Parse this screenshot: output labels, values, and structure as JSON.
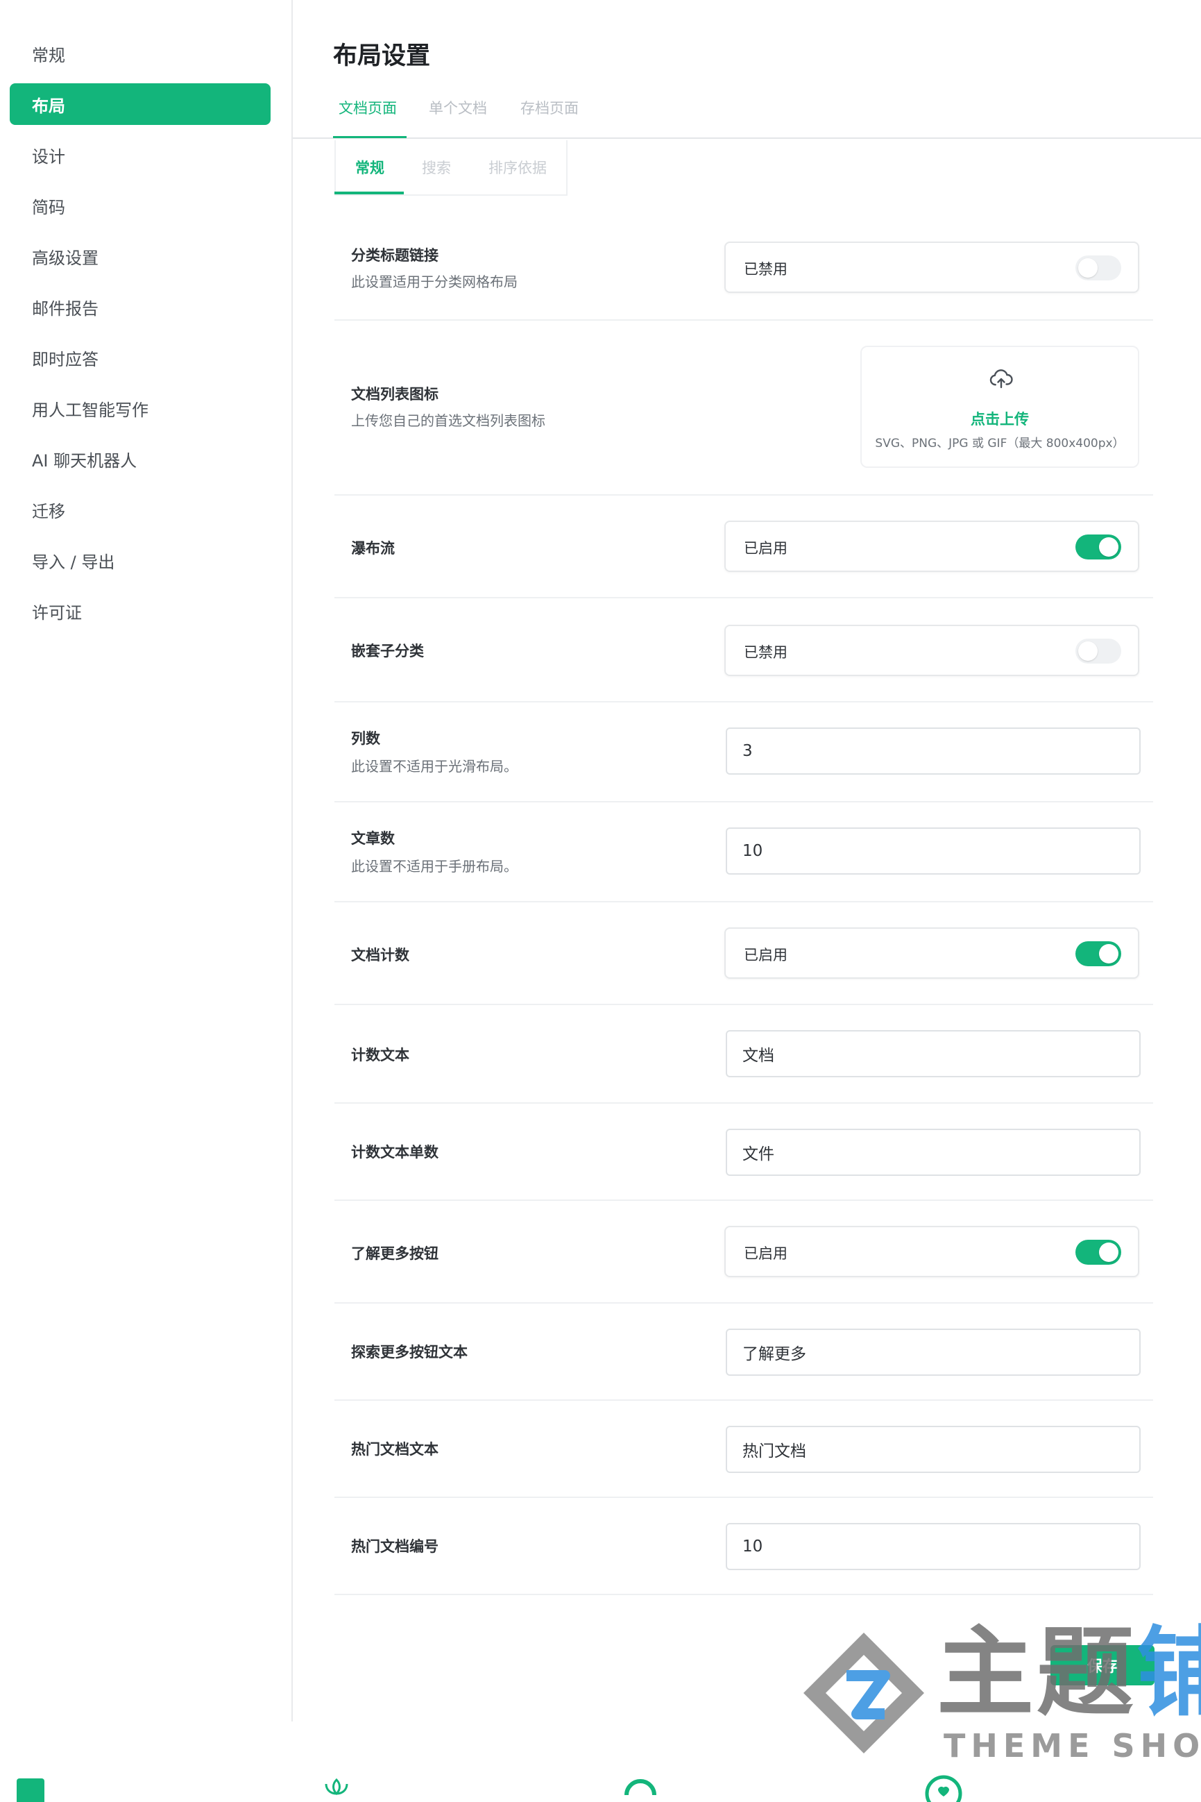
{
  "sidebar": {
    "items": [
      {
        "label": "常规",
        "active": false
      },
      {
        "label": "布局",
        "active": true
      },
      {
        "label": "设计",
        "active": false
      },
      {
        "label": "简码",
        "active": false
      },
      {
        "label": "高级设置",
        "active": false
      },
      {
        "label": "邮件报告",
        "active": false
      },
      {
        "label": "即时应答",
        "active": false
      },
      {
        "label": "用人工智能写作",
        "active": false
      },
      {
        "label": "AI 聊天机器人",
        "active": false
      },
      {
        "label": "迁移",
        "active": false
      },
      {
        "label": "导入 / 导出",
        "active": false
      },
      {
        "label": "许可证",
        "active": false
      }
    ]
  },
  "header": {
    "title": "布局设置",
    "tabs": [
      {
        "label": "文档页面",
        "active": true
      },
      {
        "label": "单个文档",
        "active": false
      },
      {
        "label": "存档页面",
        "active": false
      }
    ],
    "subtabs": [
      {
        "label": "常规",
        "active": true
      },
      {
        "label": "搜索",
        "active": false
      },
      {
        "label": "排序依据",
        "active": false
      }
    ]
  },
  "settings": {
    "category_title_link": {
      "label": "分类标题链接",
      "desc": "此设置适用于分类网格布局",
      "status": "已禁用",
      "on": false
    },
    "doc_list_icon": {
      "label": "文档列表图标",
      "desc": "上传您自己的首选文档列表图标",
      "upload_label": "点击上传",
      "upload_hint": "SVG、PNG、JPG 或 GIF（最大 800x400px）"
    },
    "masonry": {
      "label": "瀑布流",
      "status": "已启用",
      "on": true
    },
    "nested_subcategory": {
      "label": "嵌套子分类",
      "status": "已禁用",
      "on": false
    },
    "columns": {
      "label": "列数",
      "desc": "此设置不适用于光滑布局。",
      "value": "3"
    },
    "articles": {
      "label": "文章数",
      "desc": "此设置不适用于手册布局。",
      "value": "10"
    },
    "doc_count": {
      "label": "文档计数",
      "status": "已启用",
      "on": true
    },
    "count_text": {
      "label": "计数文本",
      "value": "文档"
    },
    "count_text_singular": {
      "label": "计数文本单数",
      "value": "文件"
    },
    "learn_more_button": {
      "label": "了解更多按钮",
      "status": "已启用",
      "on": true
    },
    "explore_more_text": {
      "label": "探索更多按钮文本",
      "value": "了解更多"
    },
    "popular_docs_text": {
      "label": "热门文档文本",
      "value": "热门文档"
    },
    "popular_docs_number": {
      "label": "热门文档编号",
      "value": "10"
    }
  },
  "save_label": "保存",
  "watermark": {
    "cn_main": "主题",
    "cn_accent": "铺",
    "en": "THEME SHOP"
  },
  "colors": {
    "accent": "#13b57b",
    "border": "#e6e8ea",
    "muted": "#b9bec4"
  }
}
